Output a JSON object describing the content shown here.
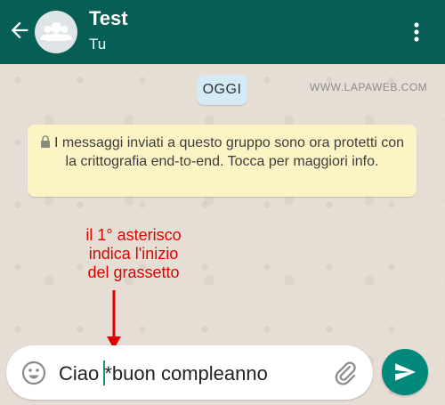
{
  "header": {
    "title": "Test",
    "subtitle": "Tu",
    "back_icon": "arrow-back-icon",
    "avatar_icon": "group-avatar-icon",
    "menu_icon": "more-vert-icon"
  },
  "chat": {
    "date_chip": "OGGI",
    "watermark": "WWW.LAPAWEB.COM",
    "encryption_notice": "I messaggi inviati a questo gruppo sono ora protetti con la crittografia end-to-end. Tocca per maggiori info."
  },
  "annotation": {
    "line1": "il 1° asterisco",
    "line2": "indica l'inizio",
    "line3": "del grassetto",
    "color": "#e00000"
  },
  "composer": {
    "text_before_cursor": "Ciao ",
    "text_after_cursor": "*buon compleanno",
    "emoji_icon": "emoji-icon",
    "attach_icon": "attach-icon",
    "send_icon": "send-icon"
  },
  "colors": {
    "header": "#075e54",
    "send_button": "#00897b",
    "notice_bg": "#fdf4c5",
    "date_chip_bg": "#d4eaf4"
  }
}
